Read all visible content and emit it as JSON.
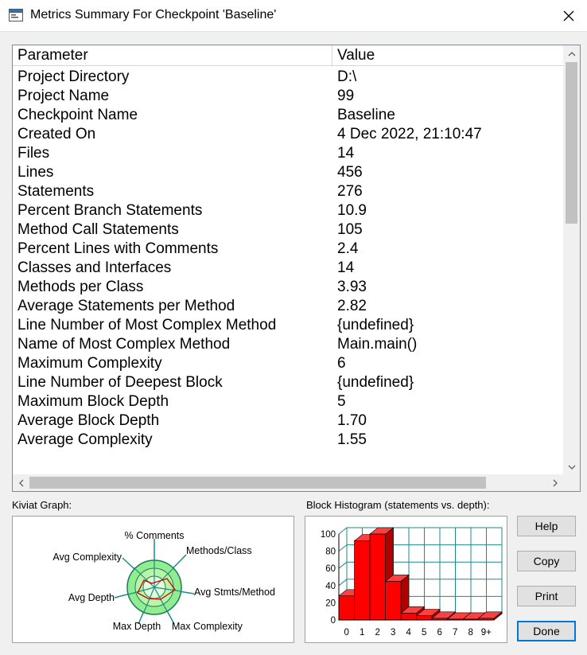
{
  "window": {
    "title": "Metrics Summary For Checkpoint 'Baseline'"
  },
  "table": {
    "headers": [
      "Parameter",
      "Value"
    ],
    "rows": [
      [
        "Project Directory",
        "D:\\"
      ],
      [
        "Project Name",
        "99"
      ],
      [
        "Checkpoint Name",
        "Baseline"
      ],
      [
        "Created On",
        "4 Dec 2022, 21:10:47"
      ],
      [
        "Files",
        "14"
      ],
      [
        "Lines",
        "456"
      ],
      [
        "Statements",
        "276"
      ],
      [
        "Percent Branch Statements",
        "10.9"
      ],
      [
        "Method Call Statements",
        "105"
      ],
      [
        "Percent Lines with Comments",
        "2.4"
      ],
      [
        "Classes and Interfaces",
        "14"
      ],
      [
        "Methods per Class",
        "3.93"
      ],
      [
        "Average Statements per Method",
        "2.82"
      ],
      [
        "Line Number of Most Complex Method",
        "{undefined}"
      ],
      [
        "Name of Most Complex Method",
        "Main.main()"
      ],
      [
        "Maximum Complexity",
        "6"
      ],
      [
        "Line Number of Deepest Block",
        "{undefined}"
      ],
      [
        "Maximum Block Depth",
        "5"
      ],
      [
        "Average Block Depth",
        "1.70"
      ],
      [
        "Average Complexity",
        "1.55"
      ]
    ]
  },
  "kiviat": {
    "label": "Kiviat Graph:",
    "axes": [
      "% Comments",
      "Methods/Class",
      "Avg Stmts/Method",
      "Max Complexity",
      "Max Depth",
      "Avg Depth",
      "Avg Complexity"
    ]
  },
  "histogram": {
    "label": "Block Histogram (statements vs. depth):"
  },
  "chart_data": {
    "type": "bar",
    "categories": [
      "0",
      "1",
      "2",
      "3",
      "4",
      "5",
      "6",
      "7",
      "8",
      "9+"
    ],
    "values": [
      28,
      92,
      100,
      45,
      8,
      5,
      2,
      1,
      1,
      2
    ],
    "yticks": [
      0,
      20,
      40,
      60,
      80,
      100
    ],
    "ylim": [
      0,
      100
    ],
    "grid": true,
    "bar_color": "#ff0000"
  },
  "buttons": {
    "help": "Help",
    "copy": "Copy",
    "print": "Print",
    "done": "Done"
  }
}
